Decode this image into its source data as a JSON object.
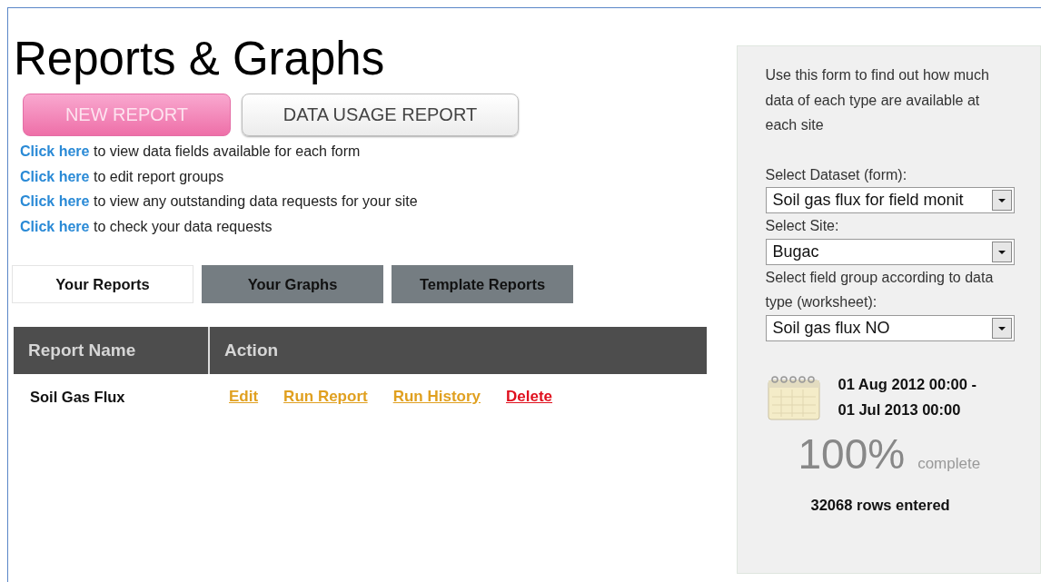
{
  "title": "Reports & Graphs",
  "buttons": [
    {
      "label": "NEW REPORT",
      "kind": "primary"
    },
    {
      "label": "DATA USAGE REPORT",
      "kind": "secondary"
    }
  ],
  "links": [
    {
      "link": "Click here",
      "text": "to view data fields available for each form"
    },
    {
      "link": "Click here",
      "text": "to edit report groups"
    },
    {
      "link": "Click here",
      "text": "to view any outstanding data requests for your site"
    },
    {
      "link": "Click here",
      "text": "to check your data requests"
    }
  ],
  "tabs": [
    {
      "label": "Your Reports",
      "selected": true
    },
    {
      "label": "Your Graphs",
      "selected": false
    },
    {
      "label": "Template Reports",
      "selected": false
    }
  ],
  "table": {
    "columns": [
      "Report Name",
      "Action"
    ],
    "rows": [
      {
        "name": "Soil Gas Flux",
        "actions": [
          {
            "label": "Edit",
            "color": "#e0a020"
          },
          {
            "label": "Run Report",
            "color": "#e0a020"
          },
          {
            "label": "Run History",
            "color": "#e0a020"
          },
          {
            "label": "Delete",
            "color": "#e0101e"
          }
        ]
      }
    ]
  },
  "sidebar": {
    "intro": "Use this form to find out how much data of each type are available at each site",
    "fields": [
      {
        "label": "Select Dataset (form):",
        "value": "Soil gas flux for field monit"
      },
      {
        "label": "Select Site:",
        "value": "Bugac"
      },
      {
        "label": "Select field group according to data type (worksheet):",
        "value": "Soil gas flux NO"
      }
    ],
    "date_range": [
      "01 Aug 2012 00:00 -",
      "01 Jul 2013 00:00"
    ],
    "percent": "100%",
    "percent_label": "complete",
    "rows_entered": "32068 rows entered"
  }
}
